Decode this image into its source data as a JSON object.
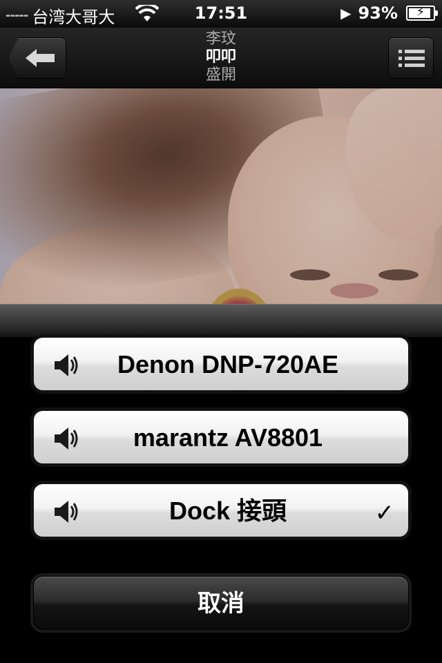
{
  "status_bar": {
    "signal": "-----",
    "carrier": "台湾大哥大",
    "time": "17:51",
    "battery": "93%",
    "battery_level": 0.93
  },
  "nav": {
    "artist": "李玟",
    "song": "叩叩",
    "album": "盛開"
  },
  "route_options": [
    {
      "label": "Denon DNP-720AE",
      "selected": false
    },
    {
      "label": "marantz AV8801",
      "selected": false
    },
    {
      "label": "Dock 接頭",
      "selected": true
    }
  ],
  "check_mark": "✓",
  "cancel_label": "取消"
}
